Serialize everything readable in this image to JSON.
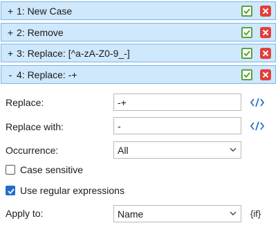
{
  "steps": [
    {
      "toggle": "+",
      "title": "1: New Case"
    },
    {
      "toggle": "+",
      "title": "2: Remove"
    },
    {
      "toggle": "+",
      "title": "3: Replace: [^a-zA-Z0-9_-]"
    },
    {
      "toggle": "-",
      "title": "4: Replace: -+"
    }
  ],
  "form": {
    "replace_label": "Replace:",
    "replace_value": "-+",
    "replace_with_label": "Replace with:",
    "replace_with_value": "-",
    "occurrence_label": "Occurrence:",
    "occurrence_value": "All",
    "case_sensitive_label": "Case sensitive",
    "case_sensitive_checked": false,
    "regex_label": "Use regular expressions",
    "regex_checked": true,
    "apply_to_label": "Apply to:",
    "apply_to_value": "Name",
    "apply_to_tag": "{if}"
  },
  "icons": {
    "apply": "checkmark-icon",
    "delete": "close-icon",
    "code": "code-icon",
    "dropdown": "chevron-down-icon"
  },
  "colors": {
    "step_bg": "#cfe8fc",
    "step_border": "#7ab4e6",
    "ok_green": "#5aa13b",
    "delete_red": "#e1403a",
    "accent_blue": "#1f6fc9"
  }
}
